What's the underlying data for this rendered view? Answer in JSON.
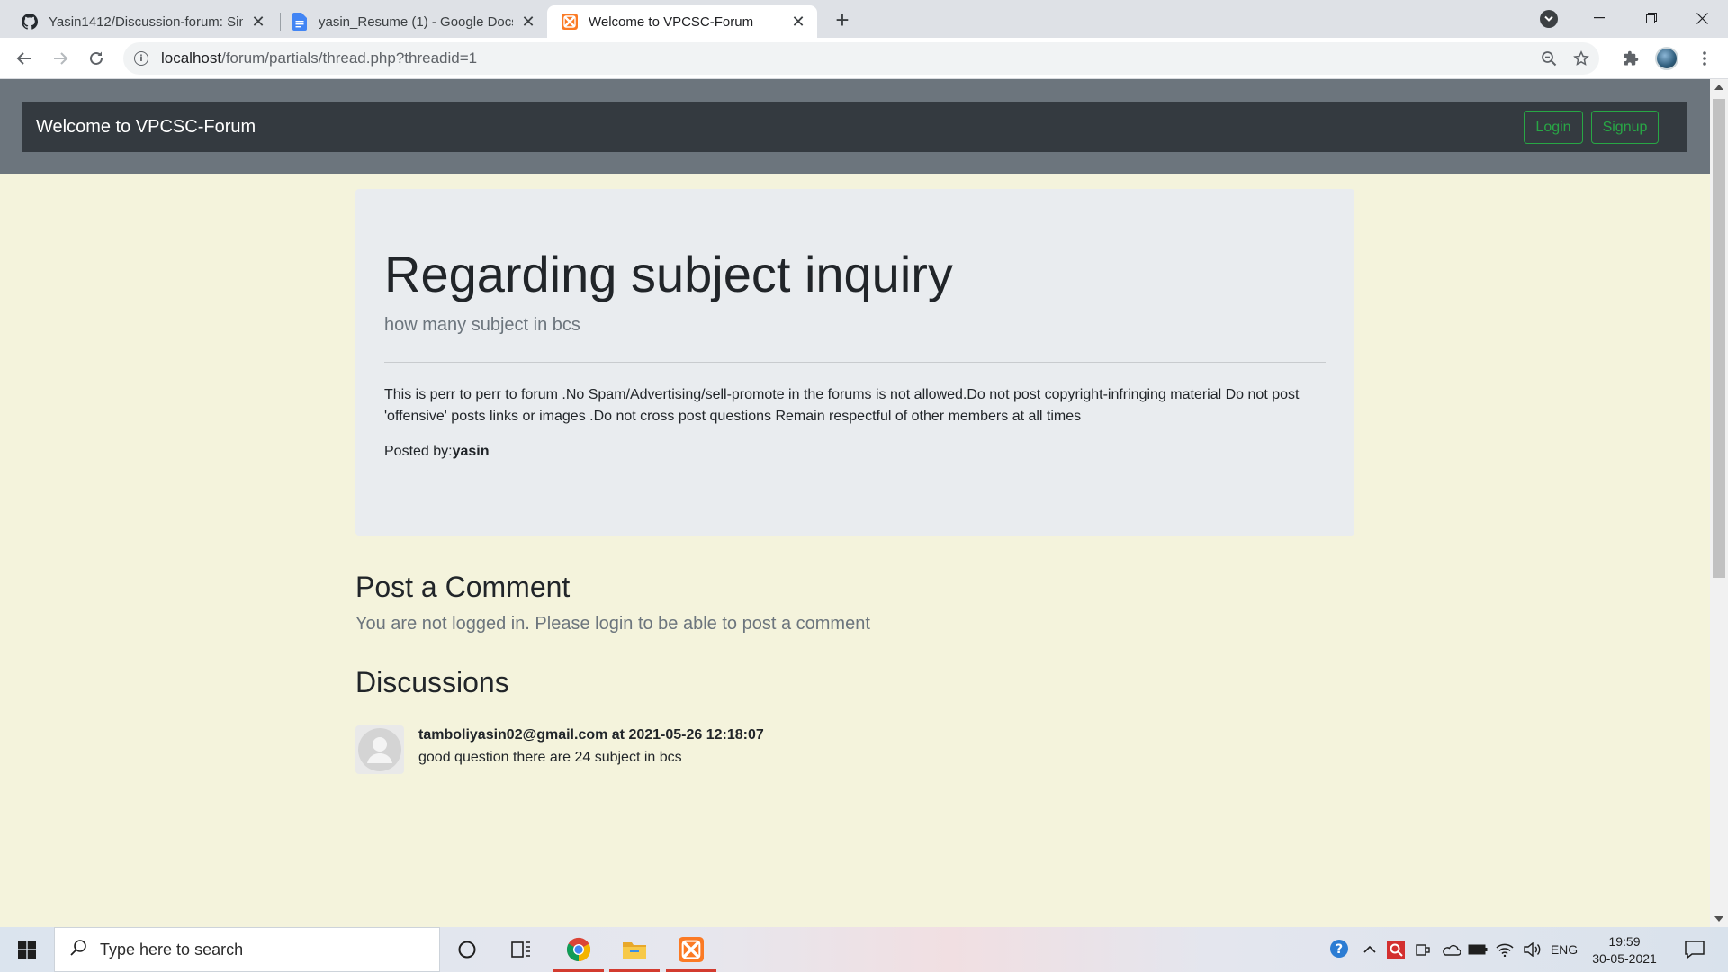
{
  "browser": {
    "tabs": [
      {
        "title": "Yasin1412/Discussion-forum: Sim",
        "icon": "github-icon",
        "active": false
      },
      {
        "title": "yasin_Resume (1) - Google Docs",
        "icon": "google-docs-icon",
        "active": false
      },
      {
        "title": "Welcome to VPCSC-Forum",
        "icon": "xampp-icon",
        "active": true
      }
    ],
    "new_tab_label": "+",
    "url_host": "localhost",
    "url_path": "/forum/partials/thread.php?threadid=1"
  },
  "navbar": {
    "brand": "Welcome to VPCSC-Forum",
    "login_label": "Login",
    "signup_label": "Signup",
    "accent_color": "#28a745"
  },
  "thread": {
    "title": "Regarding subject inquiry",
    "description": "how many subject in bcs",
    "rules": "This is perr to perr to forum .No Spam/Advertising/sell-promote in the forums is not allowed.Do not post copyright-infringing material Do not post 'offensive' posts links or images .Do not cross post questions Remain respectful of other members at all times",
    "posted_by_label": "Posted by:",
    "posted_by_user": "yasin"
  },
  "comment_section": {
    "title": "Post a Comment",
    "message": "You are not logged in. Please login to be able to post a comment"
  },
  "discussions": {
    "title": "Discussions",
    "items": [
      {
        "author_line": "tamboliyasin02@gmail.com at 2021-05-26 12:18:07",
        "text": "good question there are 24 subject in bcs"
      }
    ]
  },
  "taskbar": {
    "search_placeholder": "Type here to search",
    "language": "ENG",
    "time": "19:59",
    "date": "30-05-2021"
  }
}
